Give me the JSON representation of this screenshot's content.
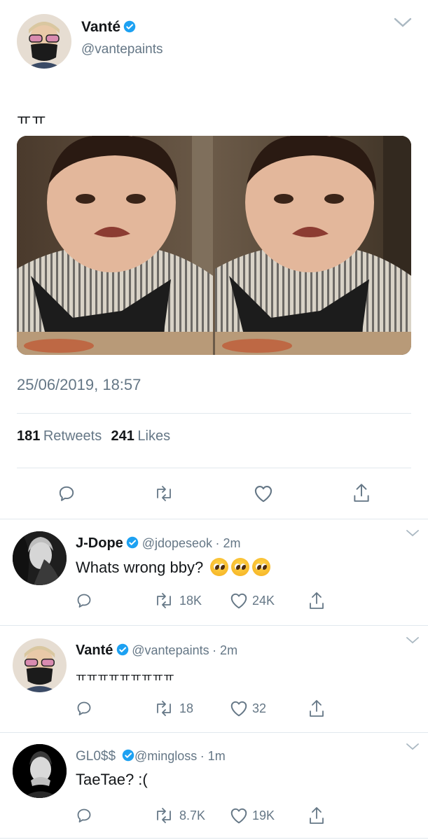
{
  "main_tweet": {
    "display_name": "Vanté",
    "handle": "@vantepaints",
    "text": "ㅠㅠ",
    "timestamp": "25/06/2019, 18:57",
    "retweets_count": "181",
    "retweets_label": "Retweets",
    "likes_count": "241",
    "likes_label": "Likes",
    "media_icon": "crying-child-photo"
  },
  "replies": [
    {
      "display_name": "J-Dope",
      "handle": "@jdopeseok",
      "time": "· 2m",
      "text": "Whats wrong bby?",
      "emoji_count": 3,
      "retweets": "18K",
      "likes": "24K"
    },
    {
      "display_name": "Vanté",
      "handle": "@vantepaints",
      "time": "· 2m",
      "text": "ㅠㅠㅠㅠㅠㅠㅠㅠㅠ",
      "retweets": "18",
      "likes": "32"
    },
    {
      "display_name": "GL0$$",
      "handle": "@mingloss",
      "time": "· 1m",
      "text": "TaeTae? :(",
      "retweets": "8.7K",
      "likes": "19K"
    }
  ],
  "colors": {
    "verified": "#1da1f2",
    "text": "#14171a",
    "secondary": "#657786",
    "divider": "#e1e8ed"
  }
}
